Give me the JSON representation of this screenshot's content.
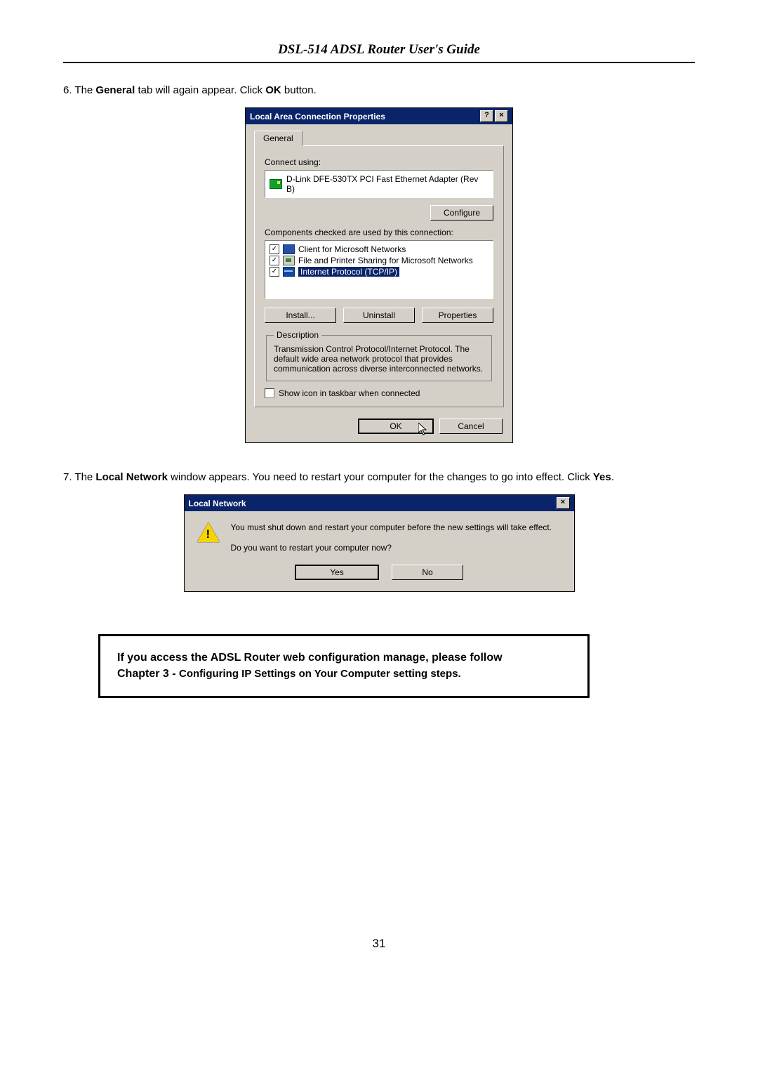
{
  "header_title": "DSL-514 ADSL Router User's Guide",
  "step6": {
    "num": "6. ",
    "pre": "The ",
    "b1": "General",
    "mid": " tab will again appear. Click ",
    "b2": "OK",
    "post": " button."
  },
  "win1": {
    "title": "Local Area Connection Properties",
    "help": "?",
    "close": "×",
    "tab": "General",
    "connect_using": "Connect using:",
    "adapter": "D-Link DFE-530TX PCI Fast Ethernet Adapter (Rev B)",
    "configure": "Configure",
    "components_label": "Components checked are used by this connection:",
    "items": [
      {
        "label": "Client for Microsoft Networks",
        "selected": false,
        "icon": "mon"
      },
      {
        "label": "File and Printer Sharing for Microsoft Networks",
        "selected": false,
        "icon": "share"
      },
      {
        "label": "Internet Protocol (TCP/IP)",
        "selected": true,
        "icon": "tcp"
      }
    ],
    "install": "Install...",
    "uninstall": "Uninstall",
    "properties": "Properties",
    "desc_legend": "Description",
    "desc_text": "Transmission Control Protocol/Internet Protocol. The default wide area network protocol that provides communication across diverse interconnected networks.",
    "show_icon": "Show icon in taskbar when connected",
    "ok": "OK",
    "cancel": "Cancel"
  },
  "step7": {
    "num": "7. ",
    "pre": "The ",
    "b1": "Local Network",
    "mid": " window appears. You need to restart your computer for the changes to go into effect. Click ",
    "b2": "Yes",
    "post": "."
  },
  "win2": {
    "title": "Local Network",
    "close": "×",
    "line1": "You must shut down and restart your computer before the new settings will take effect.",
    "line2": "Do you want to restart your computer now?",
    "yes": "Yes",
    "no": "No"
  },
  "callout": {
    "line1": "If you access the ADSL Router web configuration manage, please follow",
    "chapter": "Chapter 3 - ",
    "rest": "Configuring IP Settings on Your Computer setting steps."
  },
  "page_number": "31"
}
